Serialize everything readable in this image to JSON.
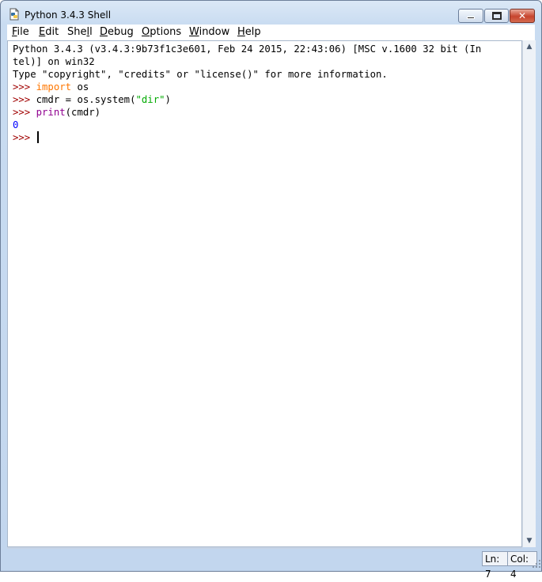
{
  "window": {
    "title": "Python 3.4.3 Shell",
    "icon": "idle-python-icon",
    "controls": {
      "minimize": "minimize-icon",
      "maximize": "maximize-icon",
      "close": "close-icon"
    }
  },
  "menu": {
    "items": [
      {
        "mnemonic": "F",
        "rest": "ile"
      },
      {
        "mnemonic": "E",
        "rest": "dit"
      },
      {
        "pre": "She",
        "mnemonic": "l",
        "rest": "l"
      },
      {
        "mnemonic": "D",
        "rest": "ebug"
      },
      {
        "mnemonic": "O",
        "rest": "ptions"
      },
      {
        "mnemonic": "W",
        "rest": "indow"
      },
      {
        "mnemonic": "H",
        "rest": "elp"
      }
    ]
  },
  "shell": {
    "banner_line1": "Python 3.4.3 (v3.4.3:9b73f1c3e601, Feb 24 2015, 22:43:06) [MSC v.1600 32 bit (In",
    "banner_line2": "tel)] on win32",
    "banner_line3": "Type \"copyright\", \"credits\" or \"license()\" for more information.",
    "prompt": ">>>",
    "line4": {
      "keyword": "import",
      "rest": " os"
    },
    "line5": {
      "before": " cmdr = os.system(",
      "string": "\"dir\"",
      "after": ")"
    },
    "line6": {
      "builtin": "print",
      "rest": "(cmdr)"
    },
    "output": "0"
  },
  "status": {
    "line": "Ln: 7",
    "column": "Col: 4"
  },
  "colors": {
    "keyword": "#ff7700",
    "builtin": "#900090",
    "string": "#00aa00",
    "prompt": "#a00000",
    "output": "#0000ff"
  }
}
